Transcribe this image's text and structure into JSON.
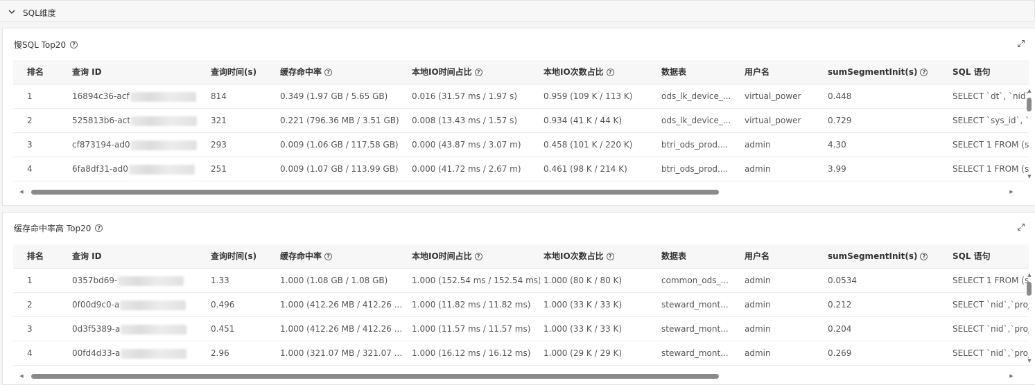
{
  "section": {
    "title": "SQL维度"
  },
  "columns": [
    {
      "label": "排名",
      "help": false
    },
    {
      "label": "查询 ID",
      "help": false
    },
    {
      "label": "查询时间(s)",
      "help": false
    },
    {
      "label": "缓存命中率",
      "help": true
    },
    {
      "label": "本地IO时间占比",
      "help": true
    },
    {
      "label": "本地IO次数占比",
      "help": true
    },
    {
      "label": "数据表",
      "help": false
    },
    {
      "label": "用户名",
      "help": false
    },
    {
      "label": "sumSegmentInit(s)",
      "help": true
    },
    {
      "label": "SQL 语句",
      "help": false
    }
  ],
  "panels": [
    {
      "title": "慢SQL Top20",
      "rows": [
        [
          "1",
          "16894c36-acf",
          "814",
          "0.349 (1.97 GB / 5.65 GB)",
          "0.016 (31.57 ms / 1.97 s)",
          "0.959 (109 K / 113 K)",
          "ods_lk_device_...",
          "virtual_power",
          "0.448",
          "SELECT `dt`, `nid`, `"
        ],
        [
          "2",
          "525813b6-act",
          "321",
          "0.221 (796.36 MB / 3.51 GB)",
          "0.008 (13.43 ms / 1.57 s)",
          "0.934 (41 K / 44 K)",
          "ods_lk_device_...",
          "virtual_power",
          "0.729",
          "SELECT `sys_id`, `d"
        ],
        [
          "3",
          "cf873194-ad0",
          "293",
          "0.009 (1.06 GB / 117.58 GB)",
          "0.000 (43.87 ms / 3.07 m)",
          "0.458 (101 K / 220 K)",
          "btri_ods_prod....",
          "admin",
          "4.30",
          "SELECT 1 FROM (s"
        ],
        [
          "4",
          "6fa8df31-ad0",
          "251",
          "0.009 (1.07 GB / 113.99 GB)",
          "0.000 (41.72 ms / 2.67 m)",
          "0.461 (98 K / 214 K)",
          "btri_ods_prod....",
          "admin",
          "3.99",
          "SELECT 1 FROM (s"
        ]
      ]
    },
    {
      "title": "缓存命中率高 Top20",
      "rows": [
        [
          "1",
          "0357bd69-",
          "1.33",
          "1.000 (1.08 GB / 1.08 GB)",
          "1.000 (152.54 ms / 152.54 ms)",
          "1.000 (80 K / 80 K)",
          "common_ods_...",
          "admin",
          "0.0534",
          "SELECT 1 FROM (s"
        ],
        [
          "2",
          "0f00d9c0-a",
          "0.496",
          "1.000 (412.26 MB / 412.26 ...",
          "1.000 (11.82 ms / 11.82 ms)",
          "1.000 (33 K / 33 K)",
          "steward_mont...",
          "admin",
          "0.212",
          "SELECT `nid`,`proje"
        ],
        [
          "3",
          "0d3f5389-a",
          "0.451",
          "1.000 (412.26 MB / 412.26 ...",
          "1.000 (11.57 ms / 11.57 ms)",
          "1.000 (33 K / 33 K)",
          "steward_mont...",
          "admin",
          "0.204",
          "SELECT `nid`,`proje"
        ],
        [
          "4",
          "00fd4d33-a",
          "2.96",
          "1.000 (321.07 MB / 321.07 ...",
          "1.000 (16.12 ms / 16.12 ms)",
          "1.000 (29 K / 29 K)",
          "steward_mont...",
          "admin",
          "0.269",
          "SELECT `nid`,`proje"
        ]
      ]
    }
  ]
}
